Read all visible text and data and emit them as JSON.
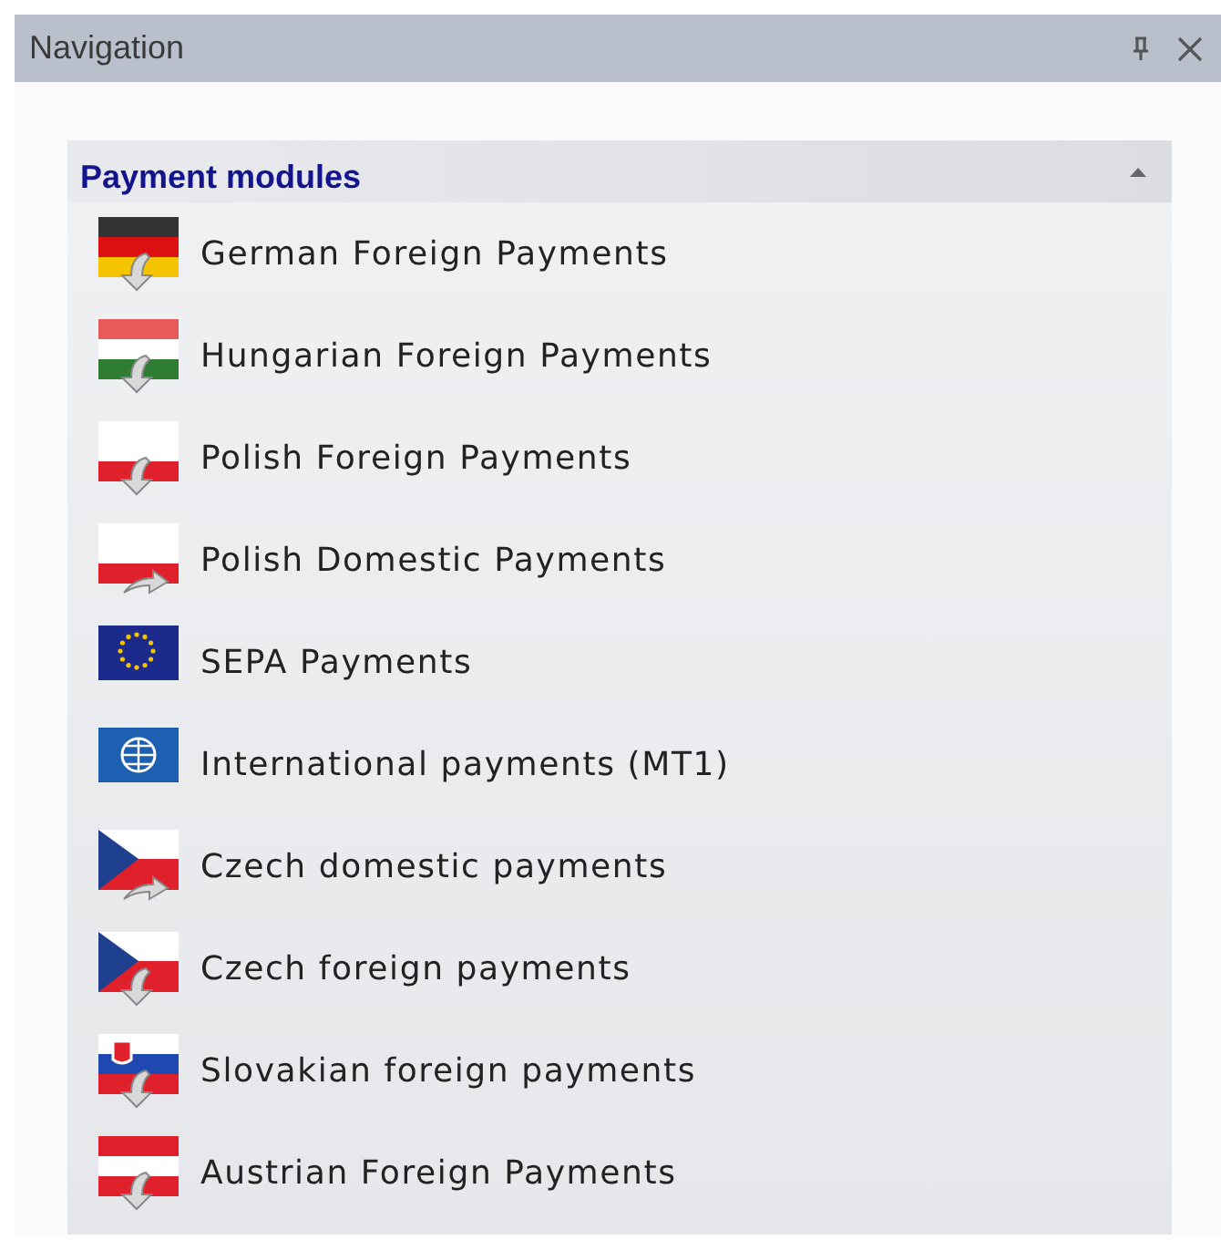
{
  "window": {
    "title": "Navigation"
  },
  "group": {
    "title": "Payment modules",
    "expanded": true
  },
  "items": [
    {
      "label": "German Foreign Payments",
      "kind": "de-down"
    },
    {
      "label": "Hungarian Foreign Payments",
      "kind": "hu-down"
    },
    {
      "label": "Polish Foreign Payments",
      "kind": "pl-down"
    },
    {
      "label": "Polish Domestic Payments",
      "kind": "pl-right"
    },
    {
      "label": "SEPA Payments",
      "kind": "eu"
    },
    {
      "label": "International payments (MT1)",
      "kind": "globe"
    },
    {
      "label": "Czech domestic payments",
      "kind": "cz-right"
    },
    {
      "label": "Czech foreign payments",
      "kind": "cz-down"
    },
    {
      "label": "Slovakian foreign payments",
      "kind": "sk-down"
    },
    {
      "label": "Austrian Foreign Payments",
      "kind": "at-down"
    }
  ]
}
